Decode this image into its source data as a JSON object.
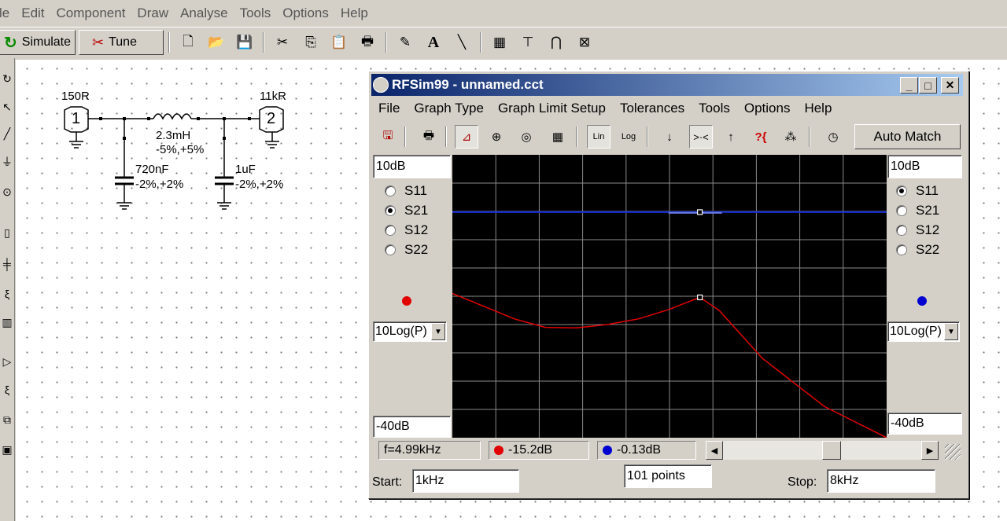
{
  "app_menu": [
    "le",
    "Edit",
    "Component",
    "Draw",
    "Analyse",
    "Tools",
    "Options",
    "Help"
  ],
  "app_toolbar": {
    "simulate_label": "Simulate",
    "tune_label": "Tune"
  },
  "schematic": {
    "port1_label": "150R",
    "port1_number": "1",
    "port2_label": "11kR",
    "port2_number": "2",
    "inductor_value": "2.3mH",
    "inductor_tol": "-5%,+5%",
    "cap1_value": "720nF",
    "cap1_tol": "-2%,+2%",
    "cap2_value": "1uF",
    "cap2_tol": "-2%,+2%"
  },
  "window": {
    "title": "RFSim99 - unnamed.cct",
    "menu": [
      "File",
      "Graph Type",
      "Graph Limit Setup",
      "Tolerances",
      "Tools",
      "Options",
      "Help"
    ],
    "auto_match_label": "Auto Match",
    "left": {
      "top_limit": "10dB",
      "bottom_limit": "-40dB",
      "scale": "10Log(P)",
      "params": [
        "S11",
        "S21",
        "S12",
        "S22"
      ],
      "selected": "S21",
      "marker_color": "#e00000"
    },
    "right": {
      "top_limit": "10dB",
      "bottom_limit": "-40dB",
      "scale": "10Log(P)",
      "params": [
        "S11",
        "S21",
        "S12",
        "S22"
      ],
      "selected": "S11",
      "marker_color": "#0000d0"
    },
    "status": {
      "freq": "f=4.99kHz",
      "left_value": "-15.2dB",
      "right_value": "-0.13dB"
    },
    "sweep": {
      "start_label": "Start:",
      "start_value": "1kHz",
      "points": "101 points",
      "stop_label": "Stop:",
      "stop_value": "8kHz"
    }
  },
  "chart_data": {
    "type": "line",
    "x_range": [
      "1kHz",
      "8kHz"
    ],
    "ylim": [
      -40,
      10
    ],
    "grid": true,
    "series": [
      {
        "name": "S21",
        "color": "#e00000",
        "x": [
          1.0,
          2.0,
          2.5,
          3.0,
          3.5,
          4.0,
          4.5,
          4.8,
          4.99,
          5.3,
          6.0,
          7.0,
          8.0
        ],
        "values": [
          -14.5,
          -19.0,
          -20.5,
          -20.6,
          -20.0,
          -19.0,
          -17.3,
          -16.0,
          -15.2,
          -17.5,
          -26.0,
          -34.5,
          -40.0
        ]
      },
      {
        "name": "S11",
        "color": "#0000d0",
        "x": [
          1.0,
          8.0
        ],
        "values": [
          -0.13,
          -0.13
        ]
      }
    ],
    "marker_x": 4.99
  }
}
